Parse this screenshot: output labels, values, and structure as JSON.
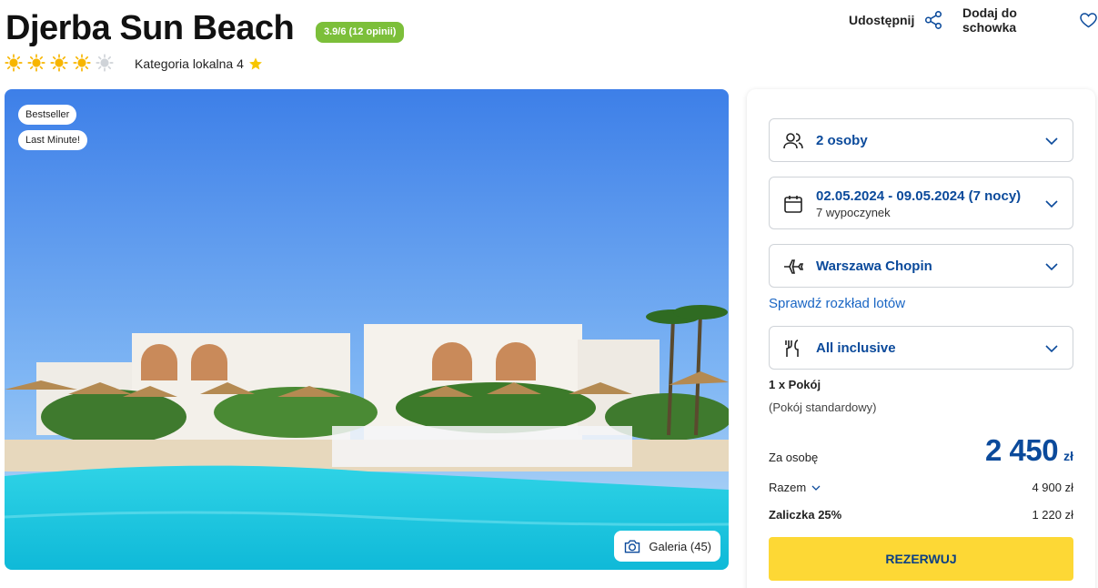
{
  "hotel": {
    "name": "Djerba Sun Beach",
    "rating_badge": "3.9/6 (12 opinii)",
    "rating_color": "#7cbf3a",
    "sun_rating": 4,
    "sun_max": 5,
    "category_label": "Kategoria lokalna 4"
  },
  "actions": {
    "share_label": "Udostępnij",
    "save_label": "Dodaj do schowka"
  },
  "gallery": {
    "tags": [
      "Bestseller",
      "Last Minute!"
    ],
    "gallery_label": "Galeria (45)"
  },
  "booking": {
    "persons": "2 osoby",
    "dates": "02.05.2024 - 09.05.2024 (7 nocy)",
    "dates_sub": "7 wypoczynek",
    "departure": "Warszawa Chopin",
    "flights_link": "Sprawdź rozkład lotów",
    "board": "All inclusive",
    "room_count": "1 x Pokój",
    "room_type": "(Pokój standardowy)",
    "per_person_label": "Za osobę",
    "price": "2 450",
    "currency": "zł",
    "total_label": "Razem",
    "total_value": "4 900 zł",
    "deposit_label": "Zaliczka 25%",
    "deposit_value": "1 220 zł",
    "book_label": "REZERWUJ"
  },
  "colors": {
    "accent_blue": "#0b4a9b",
    "link_blue": "#1a66c4",
    "button_yellow": "#fdd835",
    "sun_yellow": "#f7b500"
  }
}
